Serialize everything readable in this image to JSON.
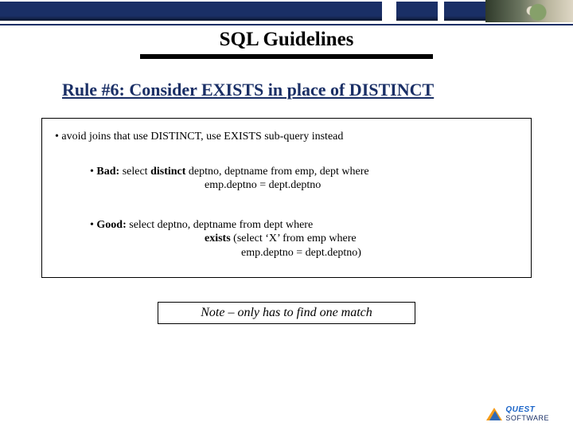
{
  "slide": {
    "title": "SQL Guidelines",
    "subtitle": "Rule #6: Consider EXISTS in place of DISTINCT",
    "content": {
      "intro": "avoid joins that use DISTINCT, use EXISTS sub-query instead",
      "bad": {
        "label": "Bad:",
        "line1a": " select ",
        "kw1": "distinct",
        "line1b": " deptno, deptname from emp, dept where",
        "line2": "emp.deptno = dept.deptno"
      },
      "good": {
        "label": "Good:",
        "line1": " select deptno, deptname from dept where",
        "line2a": "exists",
        "line2b": " (select ‘X’ from emp where",
        "line3": "emp.deptno = dept.deptno)"
      }
    },
    "note": "Note – only has to find one match"
  },
  "footer": {
    "logo_brand": "QUEST",
    "logo_sub": "SOFTWARE"
  }
}
